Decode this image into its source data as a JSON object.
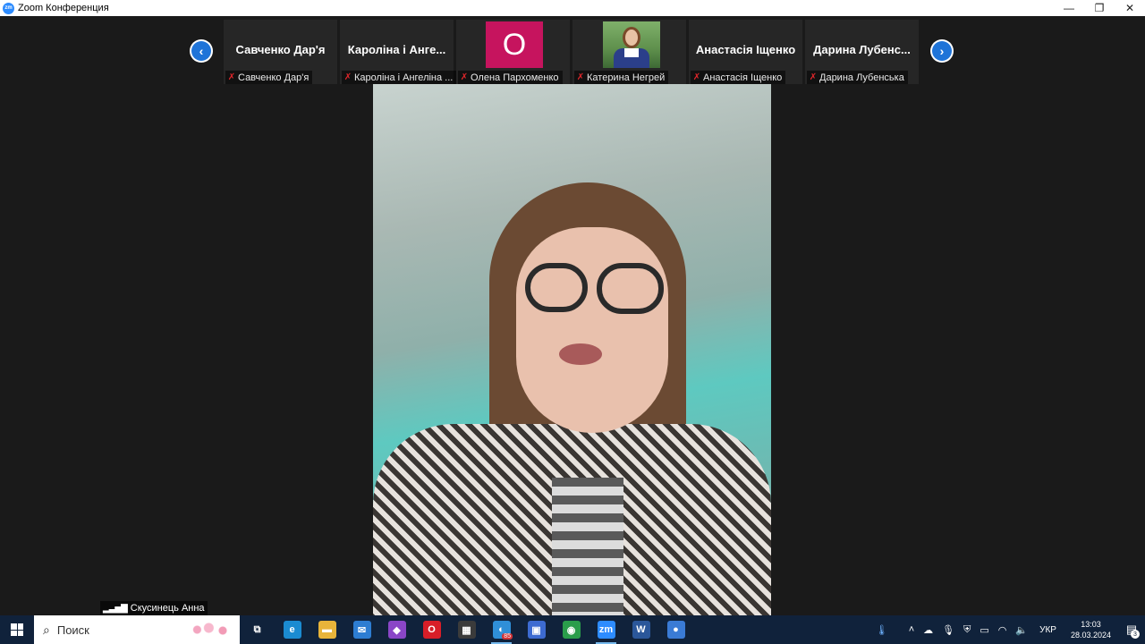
{
  "window": {
    "app_icon_text": "zm",
    "title": "Zoom Конференция",
    "controls": [
      "—",
      "❐",
      "✕"
    ]
  },
  "gallery": {
    "prev_icon": "‹",
    "next_icon": "›",
    "tiles": [
      {
        "display": "Савченко Дар'я",
        "label": "Савченко Дар'я",
        "kind": "name"
      },
      {
        "display": "Кароліна і Анге...",
        "label": "Кароліна і Ангеліна ...",
        "kind": "name"
      },
      {
        "display": "О",
        "label": "Олена Пархоменко",
        "kind": "letter",
        "color": "#c6145e"
      },
      {
        "display": "",
        "label": "Катерина Негрей",
        "kind": "photo"
      },
      {
        "display": "Анастасія Іщенко",
        "label": "Анастасія Іщенко",
        "kind": "name"
      },
      {
        "display": "Дарина  Лубенс...",
        "label": "Дарина Лубенська",
        "kind": "name"
      }
    ],
    "muted_icon": "mic-muted-icon"
  },
  "self_view": {
    "name": "Скусинець Анна",
    "signal_icon": "signal-bars-icon"
  },
  "taskbar": {
    "search_placeholder": "Поиск",
    "apps": [
      {
        "name": "task-view",
        "glyph": "⧉",
        "color": "transparent"
      },
      {
        "name": "edge",
        "glyph": "e",
        "color": "#1b8bd1"
      },
      {
        "name": "file-explorer",
        "glyph": "▬",
        "color": "#e8b43a"
      },
      {
        "name": "mail",
        "glyph": "✉",
        "color": "#2d7dd2"
      },
      {
        "name": "onenote",
        "glyph": "◆",
        "color": "#8a46c7"
      },
      {
        "name": "opera",
        "glyph": "O",
        "color": "#d81e28"
      },
      {
        "name": "clipchamp",
        "glyph": "▦",
        "color": "#3b3b3b"
      },
      {
        "name": "app-badge",
        "glyph": "◐",
        "color": "#2f8fd8",
        "badge": "85",
        "active": true
      },
      {
        "name": "save",
        "glyph": "▣",
        "color": "#3d6bd1"
      },
      {
        "name": "chrome",
        "glyph": "◉",
        "color": "#2a9d4b"
      },
      {
        "name": "zoom",
        "glyph": "zm",
        "color": "#2d8cff",
        "active": true
      },
      {
        "name": "word",
        "glyph": "W",
        "color": "#2b579a"
      },
      {
        "name": "paint",
        "glyph": "●",
        "color": "#3a7bd5"
      }
    ],
    "tray": {
      "lang": "УКР",
      "time": "13:03",
      "date": "28.03.2024",
      "notifications": "3"
    }
  }
}
